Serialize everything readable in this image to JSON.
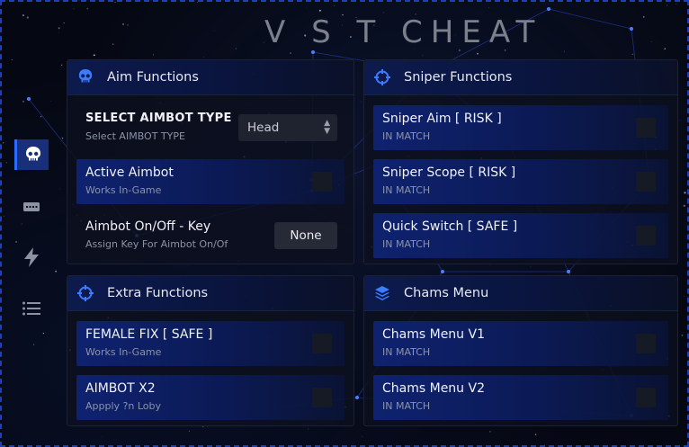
{
  "app": {
    "title": "V S T CHEAT"
  },
  "sidebar": {
    "tabs": [
      {
        "icon": "skull-icon",
        "active": true
      },
      {
        "icon": "keyboard-icon",
        "active": false
      },
      {
        "icon": "lightning-icon",
        "active": false
      },
      {
        "icon": "list-icon",
        "active": false
      }
    ]
  },
  "panels": {
    "aim": {
      "title": "Aim Functions",
      "icon": "skull-icon",
      "rows": [
        {
          "label": "SELECT AIMBOT TYPE",
          "sub": "Select AIMBOT TYPE",
          "control": "select",
          "value": "Head"
        },
        {
          "label": "Active Aimbot",
          "sub": "Works In-Game",
          "control": "checkbox"
        },
        {
          "label": "Aimbot On/Off - Key",
          "sub": "Assign Key For Aimbot On/Of",
          "control": "key",
          "value": "None"
        }
      ]
    },
    "sniper": {
      "title": "Sniper Functions",
      "icon": "crosshair-icon",
      "rows": [
        {
          "label": "Sniper Aim [ RISK ]",
          "sub": "IN MATCH",
          "control": "checkbox"
        },
        {
          "label": "Sniper Scope [ RISK ]",
          "sub": "IN MATCH",
          "control": "checkbox"
        },
        {
          "label": "Quick Switch [ SAFE ]",
          "sub": "IN MATCH",
          "control": "checkbox"
        }
      ]
    },
    "extra": {
      "title": "Extra Functions",
      "icon": "crosshair-icon",
      "rows": [
        {
          "label": "FEMALE FIX [ SAFE ]",
          "sub": "Works In-Game",
          "control": "checkbox"
        },
        {
          "label": "AIMBOT X2",
          "sub": "Appply ?n Loby",
          "control": "checkbox"
        }
      ]
    },
    "chams": {
      "title": "Chams Menu",
      "icon": "layers-icon",
      "rows": [
        {
          "label": "Chams Menu V1",
          "sub": "IN MATCH",
          "control": "checkbox"
        },
        {
          "label": "Chams Menu V2",
          "sub": "IN MATCH",
          "control": "checkbox"
        }
      ]
    }
  },
  "colors": {
    "accent": "#2b6bff",
    "row_highlight": "#0f2270",
    "border": "#1d3fb8"
  }
}
